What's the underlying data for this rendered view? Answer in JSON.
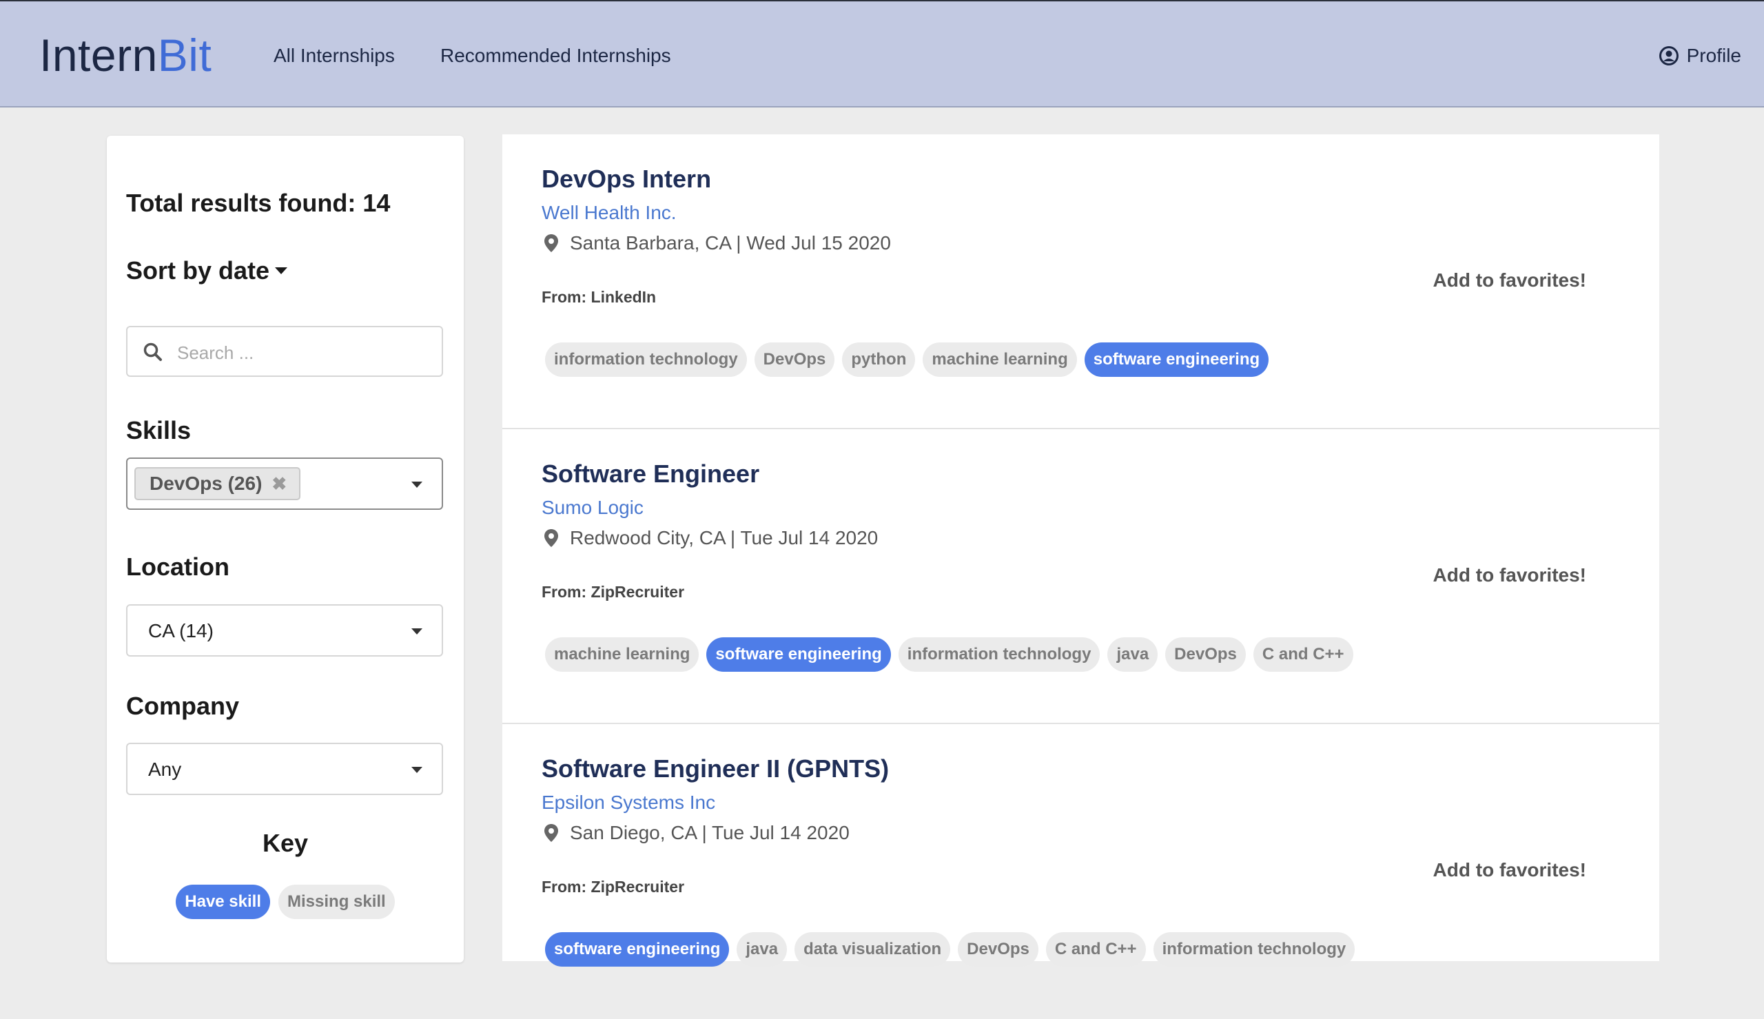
{
  "header": {
    "logo_part1": "Intern",
    "logo_part2": "Bit",
    "nav": [
      "All Internships",
      "Recommended Internships"
    ],
    "profile_label": "Profile"
  },
  "sidebar": {
    "total_label": "Total results found: 14",
    "sort_label": "Sort by date",
    "search_placeholder": "Search ...",
    "skills_label": "Skills",
    "skills_selected": "DevOps (26)",
    "location_label": "Location",
    "location_value": "CA (14)",
    "company_label": "Company",
    "company_value": "Any",
    "key_title": "Key",
    "key_have": "Have skill",
    "key_missing": "Missing skill"
  },
  "colors": {
    "accent": "#4e7de8",
    "header_bg": "#c2c9e2",
    "title": "#1f2e57"
  },
  "results": [
    {
      "title": "DevOps Intern",
      "company": "Well Health Inc.",
      "location_date": "Santa Barbara, CA | Wed Jul 15 2020",
      "source": "From: LinkedIn",
      "favorite_label": "Add to favorites!",
      "tags": [
        {
          "label": "information technology",
          "have": false
        },
        {
          "label": "DevOps",
          "have": false
        },
        {
          "label": "python",
          "have": false
        },
        {
          "label": "machine learning",
          "have": false
        },
        {
          "label": "software engineering",
          "have": true
        }
      ]
    },
    {
      "title": "Software Engineer",
      "company": "Sumo Logic",
      "location_date": "Redwood City, CA | Tue Jul 14 2020",
      "source": "From: ZipRecruiter",
      "favorite_label": "Add to favorites!",
      "tags": [
        {
          "label": "machine learning",
          "have": false
        },
        {
          "label": "software engineering",
          "have": true
        },
        {
          "label": "information technology",
          "have": false
        },
        {
          "label": "java",
          "have": false
        },
        {
          "label": "DevOps",
          "have": false
        },
        {
          "label": "C and C++",
          "have": false
        }
      ]
    },
    {
      "title": "Software Engineer II (GPNTS)",
      "company": "Epsilon Systems Inc",
      "location_date": "San Diego, CA | Tue Jul 14 2020",
      "source": "From: ZipRecruiter",
      "favorite_label": "Add to favorites!",
      "tags": [
        {
          "label": "software engineering",
          "have": true
        },
        {
          "label": "java",
          "have": false
        },
        {
          "label": "data visualization",
          "have": false
        },
        {
          "label": "DevOps",
          "have": false
        },
        {
          "label": "C and C++",
          "have": false
        },
        {
          "label": "information technology",
          "have": false
        }
      ]
    }
  ]
}
